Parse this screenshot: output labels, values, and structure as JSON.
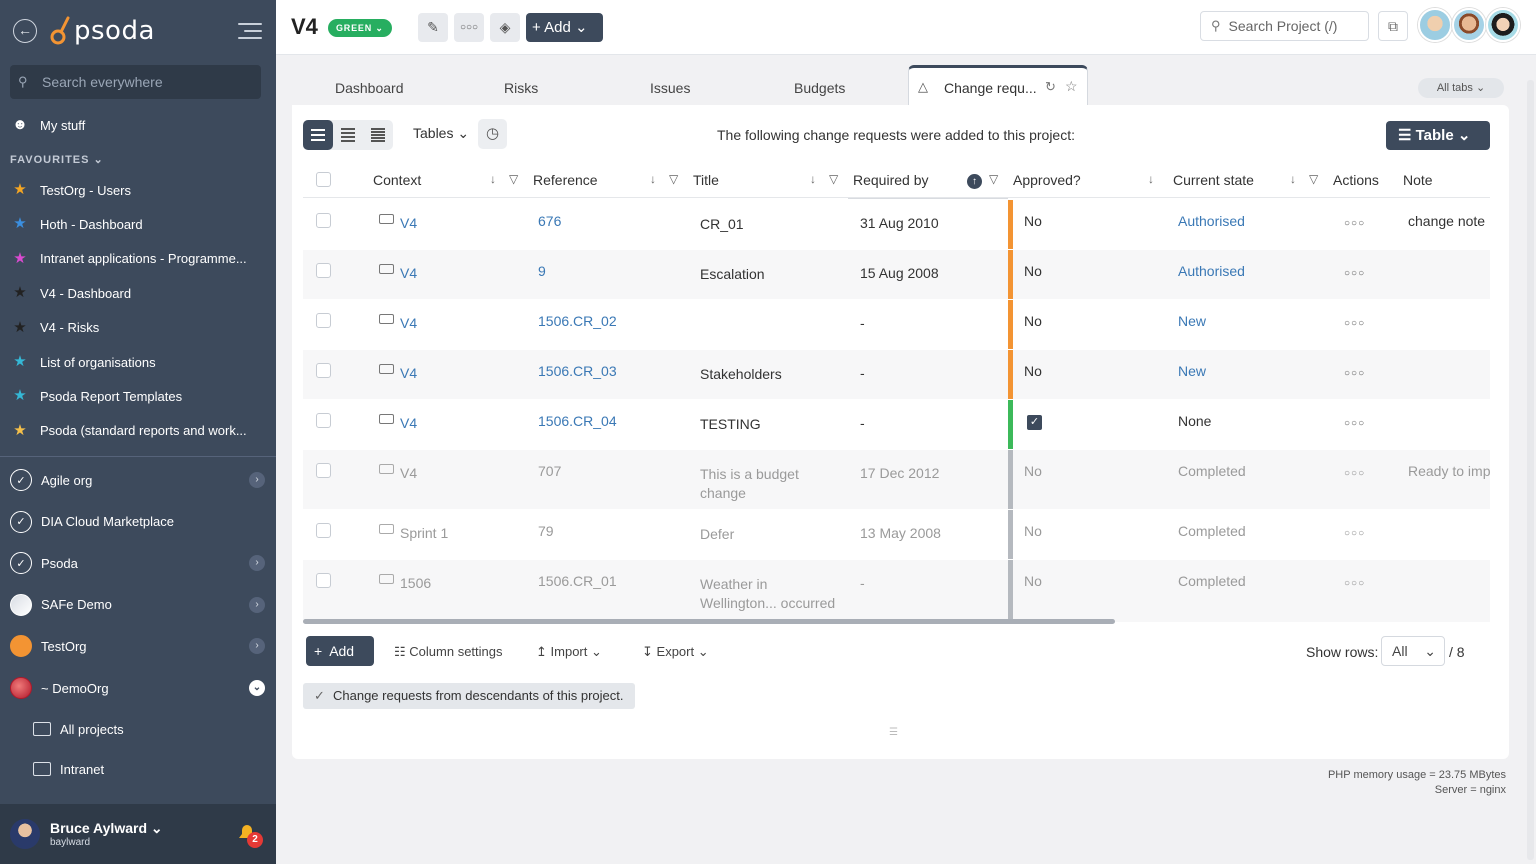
{
  "sidebar": {
    "logo_text": "psoda",
    "search_placeholder": "Search everywhere",
    "my_stuff": "My stuff",
    "favourites_heading": "FAVOURITES",
    "favourites": [
      {
        "label": "TestOrg - Users",
        "color": "#f5a623"
      },
      {
        "label": "Hoth - Dashboard",
        "color": "#3b8fe0"
      },
      {
        "label": "Intranet applications - Programme...",
        "color": "#d94bd0"
      },
      {
        "label": "V4 - Dashboard",
        "color": "#222222"
      },
      {
        "label": "V4 - Risks",
        "color": "#222222"
      },
      {
        "label": "List of organisations",
        "color": "#35b8d6"
      },
      {
        "label": "Psoda Report Templates",
        "color": "#35b8d6"
      },
      {
        "label": "Psoda (standard reports and work...",
        "color": "#f5c04a"
      }
    ],
    "orgs": [
      {
        "label": "Agile org",
        "expandable": true
      },
      {
        "label": "DIA Cloud Marketplace",
        "expandable": false
      },
      {
        "label": "Psoda",
        "expandable": true
      },
      {
        "label": "SAFe Demo",
        "expandable": true
      },
      {
        "label": "TestOrg",
        "expandable": true
      },
      {
        "label": "~ DemoOrg",
        "expandable": true,
        "open": true
      }
    ],
    "sub_items": [
      "All projects",
      "Intranet"
    ],
    "user": {
      "name": "Bruce Aylward",
      "login": "baylward",
      "notifications": "2"
    }
  },
  "topbar": {
    "project_title": "V4",
    "status": "GREEN",
    "status_color": "#27ae60",
    "add_label": "Add",
    "search_placeholder": "Search Project (/)"
  },
  "tabs": {
    "items": [
      "Dashboard",
      "Risks",
      "Issues",
      "Budgets"
    ],
    "active": "Change requ...",
    "all_tabs": "All tabs"
  },
  "toolbar": {
    "tables_label": "Tables",
    "info": "The following change requests were added to this project:",
    "view_label": "Table"
  },
  "table": {
    "columns": [
      "Context",
      "Reference",
      "Title",
      "Required by",
      "Approved?",
      "Current state",
      "Actions",
      "Note"
    ],
    "rows": [
      {
        "context": "V4",
        "reference": "676",
        "title": "CR_01",
        "required_by": "31 Aug 2010",
        "approved": "No",
        "state": "Authorised",
        "note": "change note ..",
        "bar": "#f39433",
        "faded": false,
        "state_link": true
      },
      {
        "context": "V4",
        "reference": "9",
        "title": "Escalation",
        "required_by": "15 Aug 2008",
        "approved": "No",
        "state": "Authorised",
        "note": "",
        "bar": "#f39433",
        "faded": false,
        "state_link": true
      },
      {
        "context": "V4",
        "reference": "1506.CR_02",
        "title": "",
        "required_by": "-",
        "approved": "No",
        "state": "New",
        "note": "",
        "bar": "#f39433",
        "faded": false,
        "state_link": true
      },
      {
        "context": "V4",
        "reference": "1506.CR_03",
        "title": "Stakeholders",
        "required_by": "-",
        "approved": "No",
        "state": "New",
        "note": "",
        "bar": "#f39433",
        "faded": false,
        "state_link": true
      },
      {
        "context": "V4",
        "reference": "1506.CR_04",
        "title": "TESTING",
        "required_by": "-",
        "approved": "",
        "approved_checked": true,
        "state": "None",
        "note": "",
        "bar": "#3cb95a",
        "faded": false,
        "state_link": false
      },
      {
        "context": "V4",
        "reference": "707",
        "title": "This is a budget change",
        "required_by": "17 Dec 2012",
        "approved": "No",
        "state": "Completed",
        "note": "Ready to imp",
        "bar": "#b5b9bf",
        "faded": true,
        "state_link": false
      },
      {
        "context": "Sprint 1",
        "reference": "79",
        "title": "Defer",
        "required_by": "13 May 2008",
        "approved": "No",
        "state": "Completed",
        "note": "",
        "bar": "#b5b9bf",
        "faded": true,
        "state_link": false
      },
      {
        "context": "1506",
        "reference": "1506.CR_01",
        "title": "Weather in Wellington... occurred",
        "required_by": "-",
        "approved": "No",
        "state": "Completed",
        "note": "",
        "bar": "#b5b9bf",
        "faded": true,
        "state_link": false
      }
    ]
  },
  "footer": {
    "add_label": "Add",
    "column_settings": "Column settings",
    "import": "Import",
    "export": "Export",
    "show_rows_label": "Show rows:",
    "show_rows_value": "All",
    "total": "/ 8",
    "descendants_note": "Change requests from descendants of this project."
  },
  "server": {
    "memory": "PHP memory usage = 23.75 MBytes",
    "server": "Server = nginx"
  }
}
